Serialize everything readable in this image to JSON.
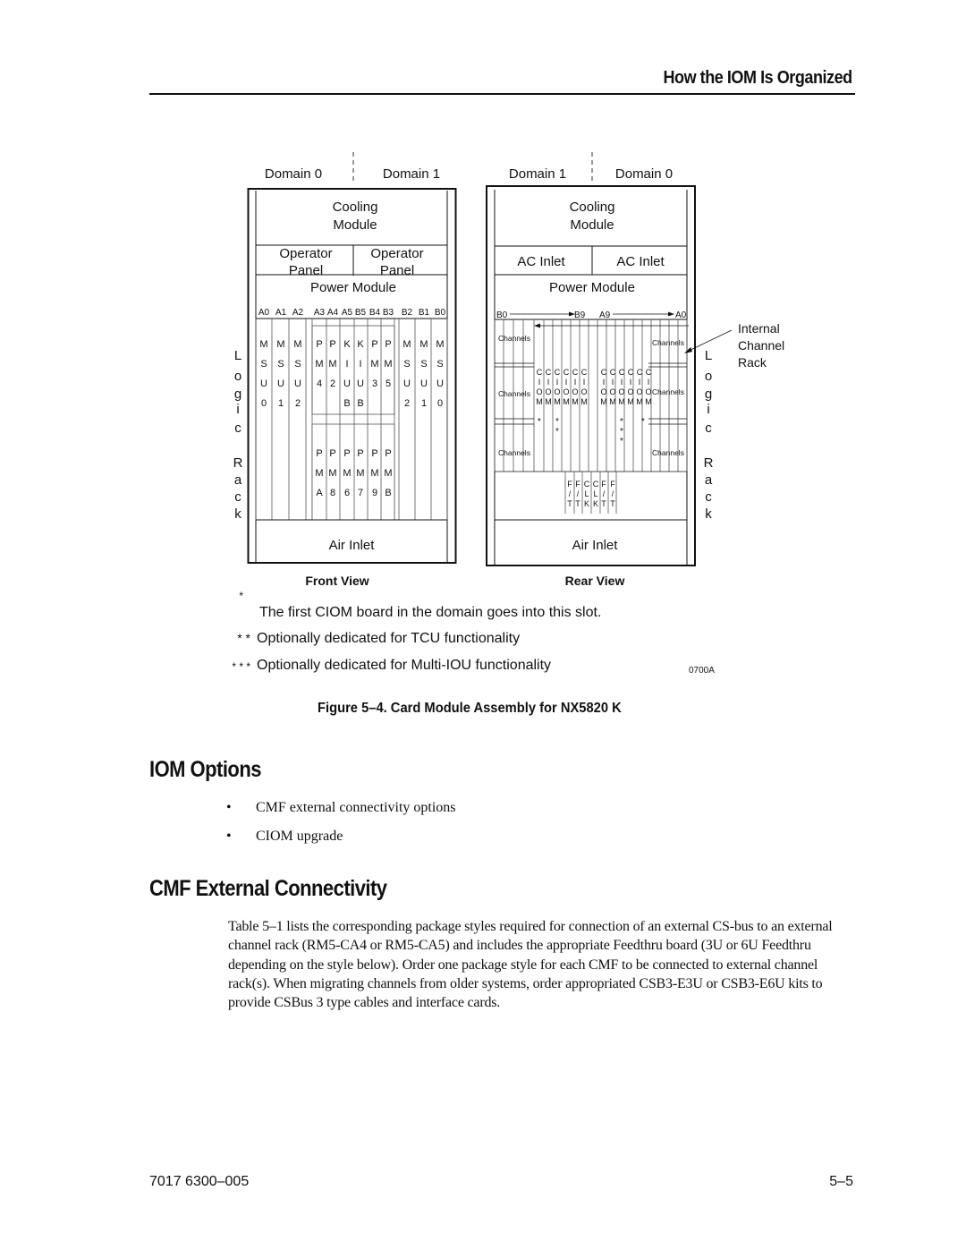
{
  "header": {
    "section_title": "How the IOM Is Organized"
  },
  "figure": {
    "front": {
      "domain_left": "Domain 0",
      "domain_right": "Domain 1",
      "cooling_line1": "Cooling",
      "cooling_line2": "Module",
      "panel_left_line1": "Operator",
      "panel_left_line2": "Panel",
      "panel_right_line1": "Operator",
      "panel_right_line2": "Panel",
      "power_module": "Power Module",
      "slot_labels": [
        "A0",
        "A1",
        "A2",
        "A3",
        "A4",
        "A5",
        "B5",
        "B4",
        "B3",
        "B2",
        "B1",
        "B0"
      ],
      "upper_cards": [
        [
          "M",
          "S",
          "U",
          "0"
        ],
        [
          "M",
          "S",
          "U",
          "1"
        ],
        [
          "M",
          "S",
          "U",
          "2"
        ],
        [
          "P",
          "M",
          "4",
          ""
        ],
        [
          "P",
          "M",
          "2",
          ""
        ],
        [
          "K",
          "I",
          "U",
          "B"
        ],
        [
          "K",
          "I",
          "U",
          "B"
        ],
        [
          "P",
          "M",
          "3",
          ""
        ],
        [
          "P",
          "M",
          "5",
          ""
        ],
        [
          "M",
          "S",
          "U",
          "2"
        ],
        [
          "M",
          "S",
          "U",
          "1"
        ],
        [
          "M",
          "S",
          "U",
          "0"
        ]
      ],
      "lower_cards": [
        [
          "P",
          "M",
          "A"
        ],
        [
          "P",
          "M",
          "8"
        ],
        [
          "P",
          "M",
          "6"
        ],
        [
          "P",
          "M",
          "7"
        ],
        [
          "P",
          "M",
          "9"
        ],
        [
          "P",
          "M",
          "B"
        ]
      ],
      "air_inlet": "Air Inlet",
      "side_label": [
        "L",
        "o",
        "g",
        "i",
        "c",
        "",
        "R",
        "a",
        "c",
        "k"
      ],
      "view_label": "Front View"
    },
    "rear": {
      "domain_left": "Domain 1",
      "domain_right": "Domain 0",
      "cooling_line1": "Cooling",
      "cooling_line2": "Module",
      "ac_inlet_left": "AC Inlet",
      "ac_inlet_right": "AC Inlet",
      "power_module": "Power Module",
      "range_left_start": "B0",
      "range_left_end": "B9",
      "range_right_start": "A9",
      "range_right_end": "A0",
      "channels_label": "Channels",
      "ciom_cards": [
        [
          "C",
          "I",
          "O",
          "M"
        ],
        [
          "C",
          "I",
          "O",
          "M"
        ],
        [
          "C",
          "I",
          "O",
          "M"
        ],
        [
          "C",
          "I",
          "O",
          "M"
        ],
        [
          "C",
          "I",
          "O",
          "M"
        ],
        [
          "C",
          "I",
          "O",
          "M"
        ]
      ],
      "ciom_marks_left": [
        "*",
        "",
        "**",
        "",
        "",
        ""
      ],
      "ciom_marks_right": [
        "",
        "",
        "***",
        "",
        "*",
        ""
      ],
      "ft_cards": [
        [
          "F",
          "/",
          "T"
        ],
        [
          "F",
          "/",
          "T"
        ],
        [
          "C",
          "L",
          "K"
        ],
        [
          "C",
          "L",
          "K"
        ],
        [
          "F",
          "/",
          "T"
        ],
        [
          "F",
          "/",
          "T"
        ]
      ],
      "air_inlet": "Air Inlet",
      "side_label": [
        "L",
        "o",
        "g",
        "i",
        "c",
        "",
        "R",
        "a",
        "c",
        "k"
      ],
      "callout_line1": "Internal",
      "callout_line2": "Channel",
      "callout_line3": "Rack",
      "view_label": "Rear View"
    },
    "notes": [
      {
        "marker": "*",
        "text": "The first CIOM board in the domain goes into this slot."
      },
      {
        "marker": "* *",
        "text": "Optionally dedicated for TCU functionality"
      },
      {
        "marker": "* * *",
        "text": "Optionally dedicated for Multi-IOU functionality"
      }
    ],
    "figure_id": "0700A",
    "caption": "Figure 5–4.  Card Module Assembly for NX5820 K"
  },
  "sections": {
    "iom_options": {
      "title": "IOM Options",
      "bullets": [
        "CMF external connectivity options",
        "CIOM upgrade"
      ],
      "bullet_glyph": "•"
    },
    "cmf": {
      "title": "CMF External Connectivity",
      "paragraph": "Table 5–1 lists the corresponding package styles required for connection of an external CS-bus to an external channel rack (RM5-CA4 or RM5-CA5) and includes the appropriate Feedthru board (3U or 6U Feedthru depending on the style below).  Order one package style for each CMF to be connected to external channel rack(s).  When migrating channels from older systems, order appropriated CSB3-E3U or CSB3-E6U kits to provide CSBus 3 type cables and interface cards."
    }
  },
  "footer": {
    "doc_number": "7017 6300–005",
    "page_number": "5–5"
  }
}
